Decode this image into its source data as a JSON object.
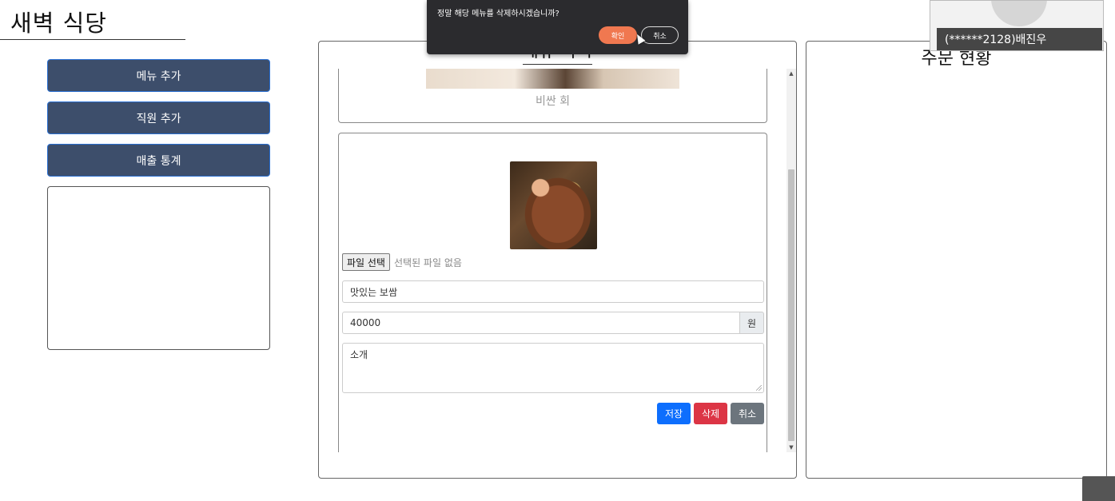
{
  "app": {
    "title": "새벽 식당"
  },
  "sidebar": {
    "buttons": [
      {
        "label": "메뉴 추가"
      },
      {
        "label": "직원 추가"
      },
      {
        "label": "매출 통계"
      }
    ]
  },
  "menu_panel": {
    "title": "메뉴 목록",
    "cards": [
      {
        "name": "비싼 회"
      }
    ],
    "edit_card": {
      "file_button": "파일 선택",
      "file_status": "선택된 파일 없음",
      "name_value": "맛있는 보쌈",
      "price_value": "40000",
      "price_unit": "원",
      "description_value": "소개",
      "save_label": "저장",
      "delete_label": "삭제",
      "cancel_label": "취소"
    }
  },
  "order_panel": {
    "title": "주문 현황"
  },
  "dialog": {
    "message": "정말 해당 메뉴를 삭제하시겠습니까?",
    "ok_label": "확인",
    "cancel_label": "취소"
  },
  "video_tile": {
    "participant_name": "(******2128)배진우"
  },
  "colors": {
    "sidebar_button": "#3d4e6b",
    "save": "#0d6efd",
    "delete": "#dc3545",
    "cancel": "#6c757d",
    "dialog_ok": "#f07850",
    "dialog_bg": "#2b2b2e"
  }
}
